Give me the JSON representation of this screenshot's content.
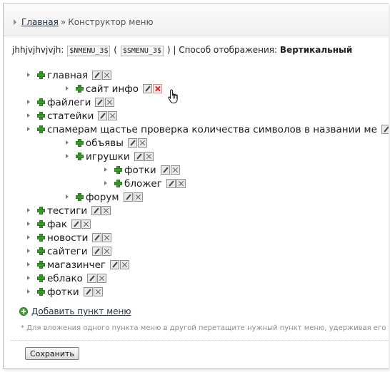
{
  "breadcrumb": {
    "home": "Главная",
    "separator": "»",
    "current": "Конструктор меню"
  },
  "info": {
    "prefix": "jhhjvjhvjvjh:",
    "code1": "$NMENU_3$",
    "paren_open": "(",
    "code2": "$SMENU_3$",
    "paren_close": ")",
    "display_label": "| Способ отображения:",
    "display_value": "Вертикальный"
  },
  "menu_items": [
    {
      "label": "главная",
      "level": 0
    },
    {
      "label": "сайт инфо",
      "level": 1
    },
    {
      "label": "файлеги",
      "level": 0
    },
    {
      "label": "статейки",
      "level": 0
    },
    {
      "label": "спамерам щастье проверка количества символов в названии ме",
      "level": 0
    },
    {
      "label": "объявы",
      "level": 1
    },
    {
      "label": "игрушки",
      "level": 1
    },
    {
      "label": "фотки",
      "level": 2
    },
    {
      "label": "бложег",
      "level": 2
    },
    {
      "label": "форум",
      "level": 1
    },
    {
      "label": "тестиги",
      "level": 0
    },
    {
      "label": "фак",
      "level": 0
    },
    {
      "label": "новости",
      "level": 0
    },
    {
      "label": "сайтеги",
      "level": 0
    },
    {
      "label": "магазинчег",
      "level": 0
    },
    {
      "label": "еблако",
      "level": 0
    },
    {
      "label": "фотки",
      "level": 0
    }
  ],
  "add_item_label": "Добавить пункт меню",
  "note": "* Для вложения одного пункта меню в другой перетащите нужный пункт меню, удерживая его за",
  "save_label": "Сохранить",
  "colors": {
    "plus": "#3c9a2c",
    "link": "#23313f",
    "delete_hover": "#dd2222"
  }
}
